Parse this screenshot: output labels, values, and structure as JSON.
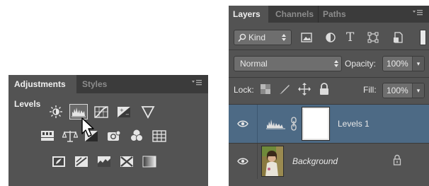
{
  "adjustments_panel": {
    "tabs": [
      "Adjustments",
      "Styles"
    ],
    "active_tab": "Adjustments",
    "menu_icon": "panel-menu-icon",
    "section_title": "Levels",
    "icon_rows": [
      [
        "brightness-contrast-icon",
        "levels-icon",
        "curves-icon",
        "exposure-icon",
        "vibrance-icon"
      ],
      [
        "hue-saturation-icon",
        "color-balance-icon",
        "black-white-icon",
        "photo-filter-icon",
        "channel-mixer-icon",
        "color-lookup-icon"
      ],
      [
        "invert-icon",
        "posterize-icon",
        "threshold-icon",
        "selective-color-icon",
        "gradient-map-icon"
      ]
    ],
    "hovered_icon": "levels-icon"
  },
  "layers_panel": {
    "tabs": [
      "Layers",
      "Channels",
      "Paths"
    ],
    "active_tab": "Layers",
    "filter": {
      "kind_label": "Kind"
    },
    "blend_mode": "Normal",
    "opacity_label": "Opacity:",
    "opacity_value": "100%",
    "lock_label": "Lock:",
    "fill_label": "Fill:",
    "fill_value": "100%",
    "layers": [
      {
        "name": "Levels 1",
        "selected": true,
        "type": "adjustment"
      },
      {
        "name": "Background",
        "selected": false,
        "type": "image",
        "locked": true
      }
    ]
  },
  "colors": {
    "panel_bg": "#535353",
    "tabbar_bg": "#3b3b3b",
    "selected_layer_bg": "#4d6a85"
  }
}
